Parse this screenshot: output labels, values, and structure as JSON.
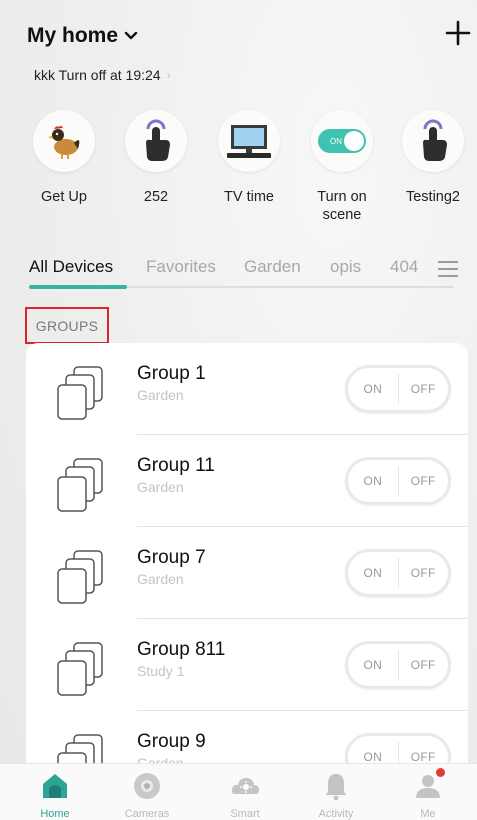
{
  "header": {
    "home_name": "My home",
    "automation_text": "kkk Turn off at 19:24"
  },
  "scenes": [
    {
      "label": "Get Up",
      "icon": "rooster-icon"
    },
    {
      "label": "252",
      "icon": "tap-hand-icon"
    },
    {
      "label": "TV time",
      "icon": "tv-icon"
    },
    {
      "label": "Turn on scene",
      "icon": "toggle-on-icon",
      "toggle_text": "ON"
    },
    {
      "label": "Testing2",
      "icon": "tap-hand-icon"
    }
  ],
  "tabs": [
    "All Devices",
    "Favorites",
    "Garden",
    "opis",
    "404"
  ],
  "active_tab": "All Devices",
  "section_title": "GROUPS",
  "groups": [
    {
      "name": "Group 1",
      "room": "Garden",
      "on_label": "ON",
      "off_label": "OFF"
    },
    {
      "name": "Group 11",
      "room": "Garden",
      "on_label": "ON",
      "off_label": "OFF"
    },
    {
      "name": "Group 7",
      "room": "Garden",
      "on_label": "ON",
      "off_label": "OFF"
    },
    {
      "name": "Group 811",
      "room": "Study 1",
      "on_label": "ON",
      "off_label": "OFF"
    },
    {
      "name": "Group 9",
      "room": "Garden",
      "on_label": "ON",
      "off_label": "OFF"
    }
  ],
  "bottom_nav": [
    {
      "label": "Home",
      "icon": "home-icon",
      "active": true
    },
    {
      "label": "Cameras",
      "icon": "camera-icon",
      "active": false
    },
    {
      "label": "Smart",
      "icon": "smart-icon",
      "active": false
    },
    {
      "label": "Activity",
      "icon": "bell-icon",
      "active": false
    },
    {
      "label": "Me",
      "icon": "person-icon",
      "active": false,
      "badge": true
    }
  ],
  "colors": {
    "accent": "#37b2a3",
    "highlight_border": "#d9262c",
    "badge": "#e53935"
  }
}
